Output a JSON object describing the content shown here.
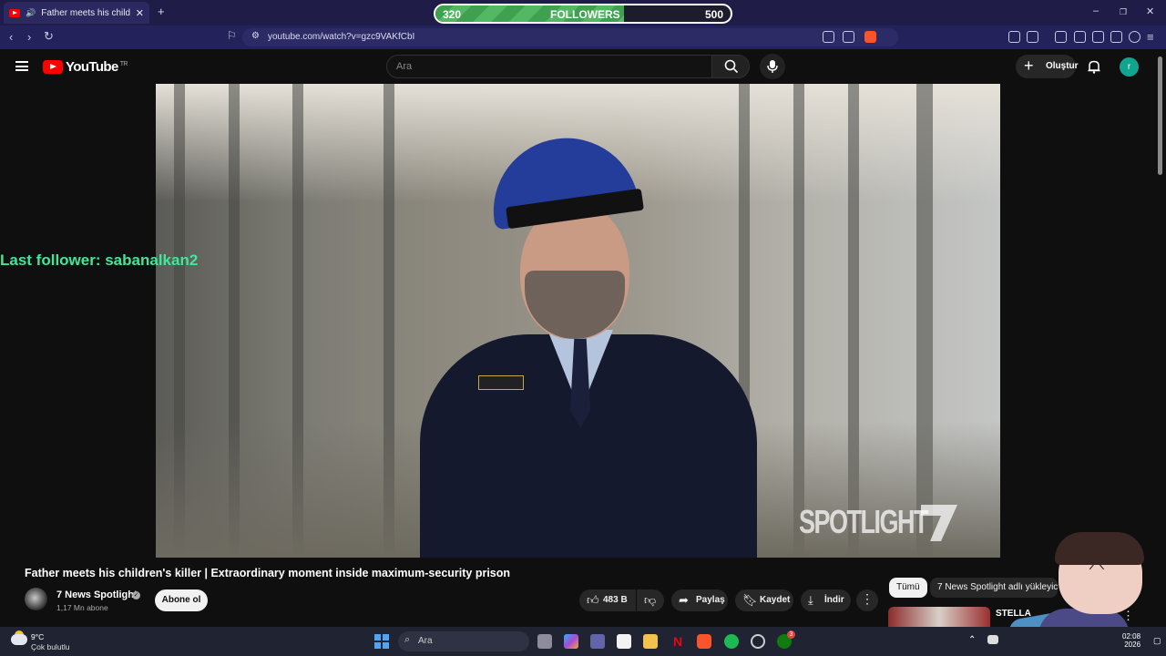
{
  "browser": {
    "tab_title": "Father meets his children's killer",
    "new_tab": "+",
    "url": "youtube.com/watch?v=gzc9VAKfCbI",
    "window_controls": [
      "–",
      "❐",
      "✕"
    ]
  },
  "followers_widget": {
    "current": "320",
    "label": "FOLLOWERS",
    "goal": "500",
    "progress": 0.64
  },
  "overlay": {
    "last_follower": "Last follower: sabanalkan2"
  },
  "youtube": {
    "logo_text": "YouTube",
    "region": "TR",
    "search_placeholder": "Ara",
    "create_label": "Oluştur",
    "avatar_letter": "r"
  },
  "video": {
    "watermark": "SPOTLIGHT",
    "title": "Father meets his children's killer | Extraordinary moment inside maximum-security prison",
    "channel_name": "7 News Spotlight",
    "subscribers": "1,17 Mn abone",
    "subscribe_label": "Abone ol",
    "likes": "483 B",
    "share_label": "Paylaş",
    "save_label": "Kaydet",
    "download_label": "İndir",
    "more_label": "⋮"
  },
  "sidebar": {
    "chips": [
      "Tümü",
      "7 News Spotlight adlı yükleyici"
    ],
    "rec_title": "STELLA"
  },
  "taskbar": {
    "temperature": "9°C",
    "weather": "Çok bulutlu",
    "search_placeholder": "Ara",
    "time": "02:08",
    "year": "2026",
    "badge": "3"
  },
  "colors": {
    "accent_green": "#3ee89b",
    "youtube_red": "#ff0000",
    "browser_bg": "#1f1d47"
  }
}
